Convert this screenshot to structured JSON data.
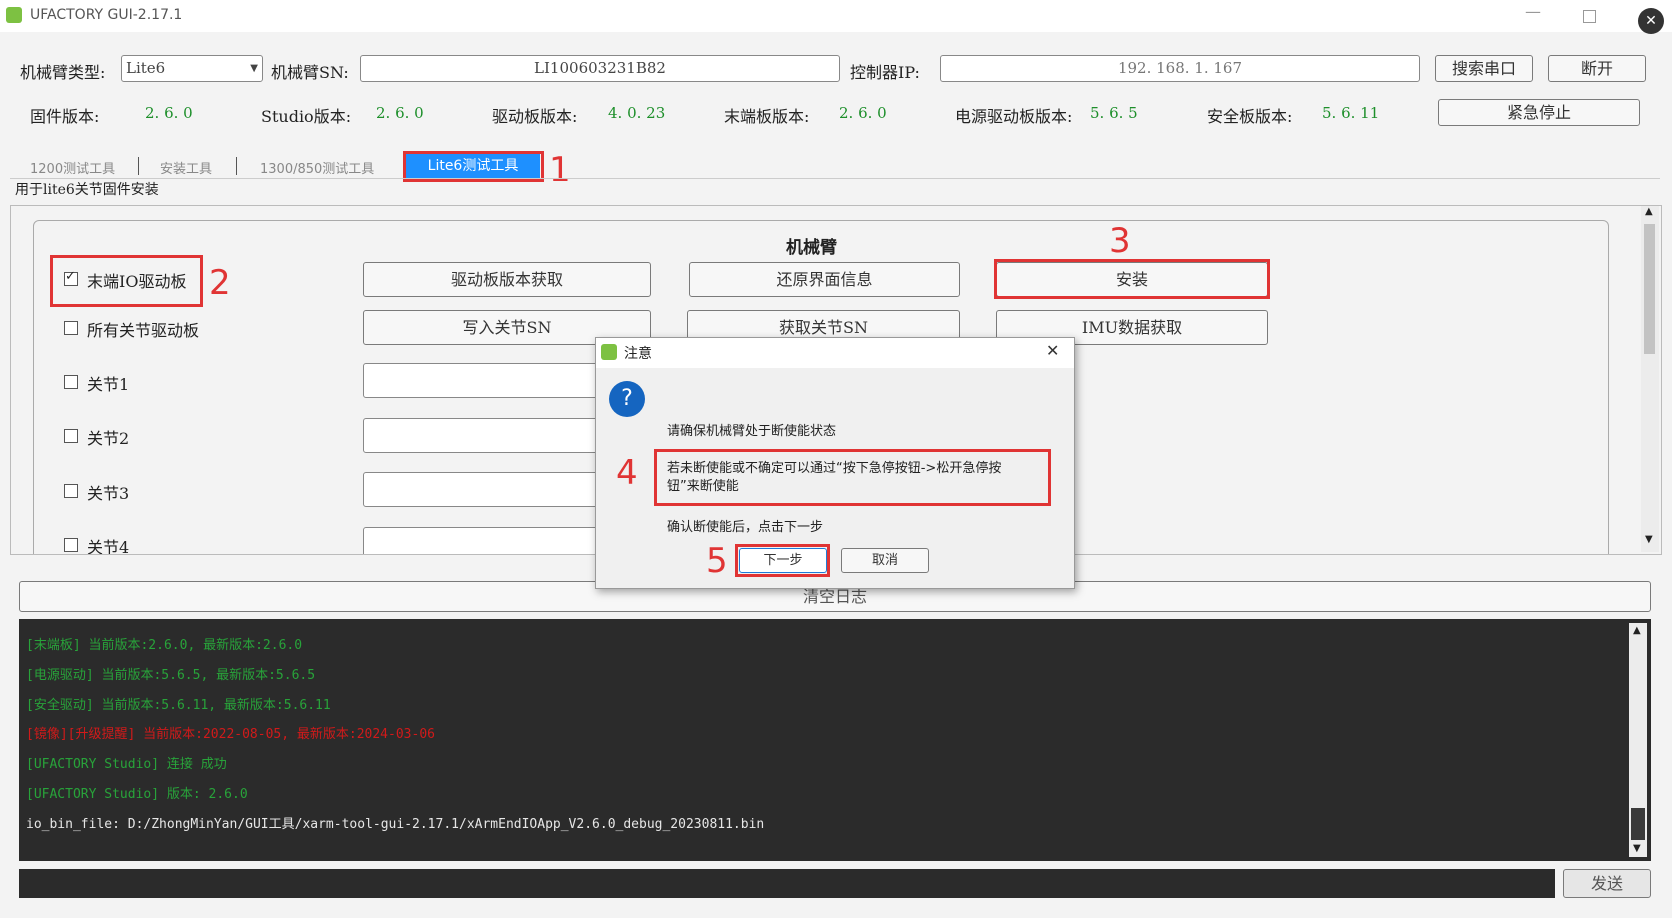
{
  "window": {
    "title": "UFACTORY GUI-2.17.1",
    "minimize_icon": "minimize-icon",
    "maximize_icon": "maximize-icon",
    "close_icon": "close-icon"
  },
  "conn": {
    "arm_type_label": "机械臂类型:",
    "arm_type_value": "Lite6",
    "arm_sn_label": "机械臂SN:",
    "arm_sn_value": "LI100603231B82",
    "controller_ip_label": "控制器IP:",
    "controller_ip_value": "192. 168. 1. 167",
    "search_port_btn": "搜索串口",
    "disconnect_btn": "断开"
  },
  "versions": {
    "firmware_label": "固件版本:",
    "firmware_value": "2. 6. 0",
    "studio_label": "Studio版本:",
    "studio_value": "2. 6. 0",
    "driver_label": "驱动板版本:",
    "driver_value": "4. 0. 23",
    "endboard_label": "末端板版本:",
    "endboard_value": "2. 6. 0",
    "power_label": "电源驱动板版本:",
    "power_value": "5. 6. 5",
    "safety_label": "安全板版本:",
    "safety_value": "5. 6. 11",
    "estop_btn": "紧急停止"
  },
  "tabs": [
    {
      "label": "1200测试工具",
      "active": false
    },
    {
      "label": "安装工具",
      "active": false
    },
    {
      "label": "1300/850测试工具",
      "active": false
    },
    {
      "label": "Lite6测试工具",
      "active": true
    }
  ],
  "tab_desc": "用于lite6关节固件安装",
  "panel": {
    "group_title": "机械臂",
    "checkboxes": [
      {
        "label": "末端IO驱动板",
        "checked": true
      },
      {
        "label": "所有关节驱动板",
        "checked": false
      },
      {
        "label": "关节1",
        "checked": false
      },
      {
        "label": "关节2",
        "checked": false
      },
      {
        "label": "关节3",
        "checked": false
      },
      {
        "label": "关节4",
        "checked": false
      }
    ],
    "btn_get_driver_version": "驱动板版本获取",
    "btn_restore_ui": "还原界面信息",
    "btn_install": "安装",
    "btn_write_joint_sn": "写入关节SN",
    "btn_get_joint_sn": "获取关节SN",
    "btn_get_imu": "IMU数据获取"
  },
  "dialog": {
    "title": "注意",
    "icon": "question-icon",
    "line1": "请确保机械臂处于断使能状态",
    "line2a": "若未断使能或不确定可以通过“按下急停按钮->松开急停按",
    "line2b": "钮”来断使能",
    "line3": "确认断使能后，点击下一步",
    "next_btn": "下一步",
    "cancel_btn": "取消"
  },
  "annotations": [
    "1",
    "2",
    "3",
    "4",
    "5"
  ],
  "log": {
    "clear_btn": "清空日志",
    "lines": [
      {
        "text": "[末端板] 当前版本:2.6.0, 最新版本:2.6.0",
        "color": "#28a33a"
      },
      {
        "text": "[电源驱动] 当前版本:5.6.5, 最新版本:5.6.5",
        "color": "#28a33a"
      },
      {
        "text": "[安全驱动] 当前版本:5.6.11, 最新版本:5.6.11",
        "color": "#28a33a"
      },
      {
        "text": "[镜像][升级提醒] 当前版本:2022-08-05, 最新版本:2024-03-06",
        "color": "#d11a1a"
      },
      {
        "text": "[UFACTORY Studio] 连接 成功",
        "color": "#28a33a"
      },
      {
        "text": "[UFACTORY Studio] 版本: 2.6.0",
        "color": "#28a33a"
      },
      {
        "text": "io_bin_file: D:/ZhongMinYan/GUI工具/xarm-tool-gui-2.17.1/xArmEndIOApp_V2.6.0_debug_20230811.bin",
        "color": "#e6e6e6"
      }
    ],
    "send_btn": "发送"
  },
  "colors": {
    "accent": "#1e90ff",
    "highlight": "#e03434",
    "log_bg": "#2b2b2b"
  }
}
